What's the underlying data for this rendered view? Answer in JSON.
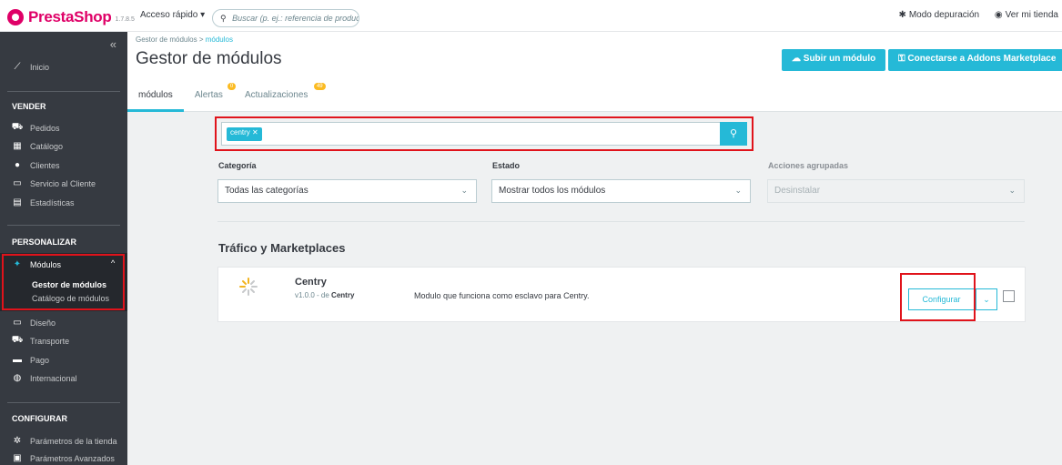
{
  "topbar": {
    "brand": "PrestaShop",
    "version": "1.7.8.5",
    "quick_access": "Acceso rápido ▾",
    "search_placeholder": "Buscar (p. ej.: referencia de producto,",
    "debug_mode": "Modo depuración",
    "view_store": "Ver mi tienda"
  },
  "sidebar": {
    "collapse": "«",
    "home": "Inicio",
    "sections": [
      {
        "title": "VENDER",
        "items": [
          "Pedidos",
          "Catálogo",
          "Clientes",
          "Servicio al Cliente",
          "Estadísticas"
        ]
      },
      {
        "title": "PERSONALIZAR",
        "items": [
          "Módulos",
          "Diseño",
          "Transporte",
          "Pago",
          "Internacional"
        ]
      },
      {
        "title": "CONFIGURAR",
        "items": [
          "Parámetros de la tienda",
          "Parámetros Avanzados"
        ]
      }
    ],
    "modules_sub": [
      "Gestor de módulos",
      "Catálogo de módulos"
    ],
    "expand_glyph": "^"
  },
  "header": {
    "breadcrumb_parent": "Gestor de módulos",
    "breadcrumb_sep": ">",
    "breadcrumb_current": "módulos",
    "title": "Gestor de módulos",
    "upload_btn": "Subir un módulo",
    "connect_btn": "Conectarse a Addons Marketplace",
    "tabs": [
      {
        "label": "módulos"
      },
      {
        "label": "Alertas",
        "badge": "0"
      },
      {
        "label": "Actualizaciones",
        "badge": "49"
      }
    ]
  },
  "filters": {
    "chip": "centry",
    "chip_close": "✕",
    "category_label": "Categoría",
    "category_value": "Todas las categorías",
    "status_label": "Estado",
    "status_value": "Mostrar todos los módulos",
    "bulk_label": "Acciones agrupadas",
    "bulk_value": "Desinstalar"
  },
  "section": {
    "title": "Tráfico y Marketplaces"
  },
  "module": {
    "name": "Centry",
    "version": "v1.0.0 - de",
    "author": "Centry",
    "description": "Modulo que funciona como esclavo para Centry.",
    "configure": "Configurar"
  },
  "colors": {
    "accent": "#25b9d7",
    "brand": "#df0067",
    "highlight": "#e0131b",
    "sidebar": "#363a41"
  },
  "icons": {
    "search": "⚲",
    "chevron_down": "⌄",
    "upload": "☁",
    "connect": "⚿"
  }
}
